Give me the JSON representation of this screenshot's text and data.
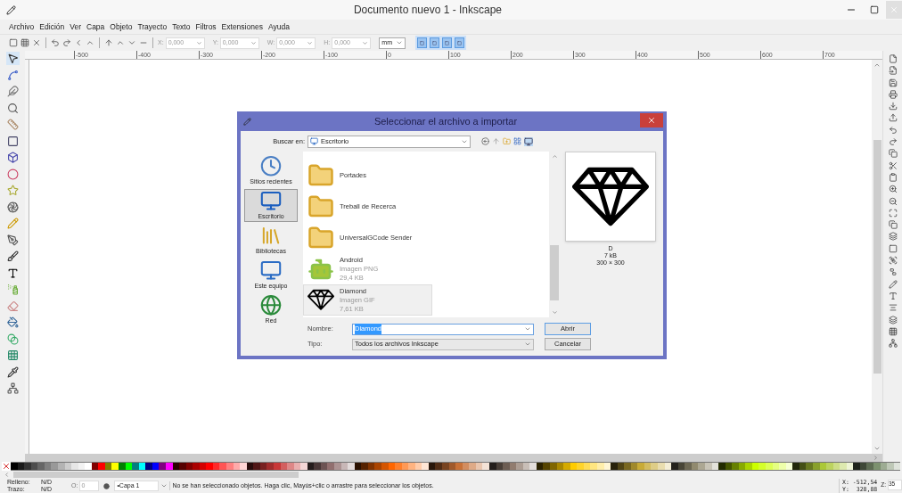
{
  "window": {
    "title": "Documento nuevo 1 - Inkscape"
  },
  "menu": [
    "Archivo",
    "Edición",
    "Ver",
    "Capa",
    "Objeto",
    "Trayecto",
    "Texto",
    "Filtros",
    "Extensiones",
    "Ayuda"
  ],
  "toolbar": {
    "fields": [
      {
        "label": "X:",
        "value": "0,000"
      },
      {
        "label": "Y:",
        "value": "0,000"
      },
      {
        "label": "W:",
        "value": "0,000"
      },
      {
        "label": "H:",
        "value": "0,000"
      }
    ],
    "unit": "mm",
    "toggles": [
      {
        "on": true
      },
      {
        "on": true
      },
      {
        "on": true
      },
      {
        "on": true
      }
    ]
  },
  "ruler": [
    "-500",
    "-400",
    "-300",
    "-200",
    "-100",
    "0",
    "100",
    "200",
    "300",
    "400",
    "500",
    "600",
    "700"
  ],
  "dialog": {
    "title": "Seleccionar el archivo a importar",
    "look_in_label": "Buscar en:",
    "look_in": "Escritorio",
    "places": [
      {
        "label": "Sitios recientes",
        "selected": false
      },
      {
        "label": "Escritorio",
        "selected": true
      },
      {
        "label": "Bibliotecas",
        "selected": false
      },
      {
        "label": "Este equipo",
        "selected": false
      },
      {
        "label": "Red",
        "selected": false
      }
    ],
    "files": [
      {
        "kind": "folder",
        "name": "Portades",
        "selected": false
      },
      {
        "kind": "folder",
        "name": "Treball de Recerca",
        "selected": false
      },
      {
        "kind": "folder",
        "name": "UniversalGCode Sender",
        "selected": false
      },
      {
        "kind": "png",
        "name": "Android",
        "type": "Imagen PNG",
        "size": "29,4 KB",
        "selected": false
      },
      {
        "kind": "gif",
        "name": "Diamond",
        "type": "Imagen GIF",
        "size": "7,61 KB",
        "selected": true
      }
    ],
    "preview_info": [
      "D",
      "7 kB",
      "300 × 300"
    ],
    "name_label": "Nombre:",
    "name_value": "Diamond",
    "type_label": "Tipo:",
    "type_value": "Todos los archivos Inkscape",
    "open": "Abrir",
    "cancel": "Cancelar"
  },
  "palette": [
    {
      "color": "#000000"
    },
    {
      "color": "#1a1a1a"
    },
    {
      "color": "#333333"
    },
    {
      "color": "#4d4d4d"
    },
    {
      "color": "#666666"
    },
    {
      "color": "#808080"
    },
    {
      "color": "#999999"
    },
    {
      "color": "#b3b3b3"
    },
    {
      "color": "#cccccc"
    },
    {
      "color": "#e6e6e6"
    },
    {
      "color": "#f2f2f2"
    },
    {
      "color": "#ffffff"
    },
    {
      "color": "#800000"
    },
    {
      "color": "#ff0000"
    },
    {
      "color": "#808000"
    },
    {
      "color": "#ffff00"
    },
    {
      "color": "#008000"
    },
    {
      "color": "#00ff00"
    },
    {
      "color": "#008080"
    },
    {
      "color": "#00ffff"
    },
    {
      "color": "#000080"
    },
    {
      "color": "#0000ff"
    },
    {
      "color": "#800080"
    },
    {
      "color": "#ff00ff"
    },
    {
      "color": "#2b0000"
    },
    {
      "color": "#550000"
    },
    {
      "color": "#800000"
    },
    {
      "color": "#aa0000"
    },
    {
      "color": "#d40000"
    },
    {
      "color": "#ff0000"
    },
    {
      "color": "#ff2a2a"
    },
    {
      "color": "#ff5555"
    },
    {
      "color": "#ff8080"
    },
    {
      "color": "#ffaaaa"
    },
    {
      "color": "#ffd5d5"
    },
    {
      "color": "#280b0b"
    },
    {
      "color": "#501616"
    },
    {
      "color": "#782121"
    },
    {
      "color": "#a02c2c"
    },
    {
      "color": "#c83737"
    },
    {
      "color": "#d35f5f"
    },
    {
      "color": "#de8787"
    },
    {
      "color": "#e9afaf"
    },
    {
      "color": "#f4d7d7"
    },
    {
      "color": "#241c1c"
    },
    {
      "color": "#483737"
    },
    {
      "color": "#6c5353"
    },
    {
      "color": "#916f6f"
    },
    {
      "color": "#ac9393"
    },
    {
      "color": "#c8b7b7"
    },
    {
      "color": "#e3dbdb"
    },
    {
      "color": "#2b1100"
    },
    {
      "color": "#552200"
    },
    {
      "color": "#803300"
    },
    {
      "color": "#aa4400"
    },
    {
      "color": "#d45500"
    },
    {
      "color": "#ff6600"
    },
    {
      "color": "#ff7f2a"
    },
    {
      "color": "#ff9955"
    },
    {
      "color": "#ffb380"
    },
    {
      "color": "#ffccaa"
    },
    {
      "color": "#ffe6d5"
    },
    {
      "color": "#28170b"
    },
    {
      "color": "#502d16"
    },
    {
      "color": "#784421"
    },
    {
      "color": "#a05a2c"
    },
    {
      "color": "#c87137"
    },
    {
      "color": "#d38d5f"
    },
    {
      "color": "#deaa87"
    },
    {
      "color": "#e9c6af"
    },
    {
      "color": "#f4e3d7"
    },
    {
      "color": "#241f1c"
    },
    {
      "color": "#483e37"
    },
    {
      "color": "#6c5d53"
    },
    {
      "color": "#917c6f"
    },
    {
      "color": "#ac9d93"
    },
    {
      "color": "#c8beb7"
    },
    {
      "color": "#e3dedb"
    },
    {
      "color": "#2b2200"
    },
    {
      "color": "#554400"
    },
    {
      "color": "#806600"
    },
    {
      "color": "#aa8800"
    },
    {
      "color": "#d4aa00"
    },
    {
      "color": "#ffcc00"
    },
    {
      "color": "#ffd42a"
    },
    {
      "color": "#ffdd55"
    },
    {
      "color": "#ffe680"
    },
    {
      "color": "#ffeeaa"
    },
    {
      "color": "#fff6d5"
    },
    {
      "color": "#28220b"
    },
    {
      "color": "#504416"
    },
    {
      "color": "#786721"
    },
    {
      "color": "#a0892c"
    },
    {
      "color": "#c8ab37"
    },
    {
      "color": "#d3bc5f"
    },
    {
      "color": "#decd87"
    },
    {
      "color": "#e9ddaf"
    },
    {
      "color": "#f4eed7"
    },
    {
      "color": "#24221c"
    },
    {
      "color": "#484537"
    },
    {
      "color": "#6c6753"
    },
    {
      "color": "#918a6f"
    },
    {
      "color": "#aca793"
    },
    {
      "color": "#c8c4b7"
    },
    {
      "color": "#e3e2db"
    },
    {
      "color": "#222b00"
    },
    {
      "color": "#445500"
    },
    {
      "color": "#668000"
    },
    {
      "color": "#88aa00"
    },
    {
      "color": "#aad400"
    },
    {
      "color": "#ccff00"
    },
    {
      "color": "#d4ff2a"
    },
    {
      "color": "#ddff55"
    },
    {
      "color": "#e5ff80"
    },
    {
      "color": "#eeffaa"
    },
    {
      "color": "#f6ffd5"
    },
    {
      "color": "#22280b"
    },
    {
      "color": "#445016"
    },
    {
      "color": "#677821"
    },
    {
      "color": "#89a02c"
    },
    {
      "color": "#abc837"
    },
    {
      "color": "#bcd35f"
    },
    {
      "color": "#cdde87"
    },
    {
      "color": "#dde9af"
    },
    {
      "color": "#eef4d7"
    },
    {
      "color": "#1f241c"
    },
    {
      "color": "#3e4837"
    },
    {
      "color": "#5d6c53"
    },
    {
      "color": "#7c916f"
    },
    {
      "color": "#9dac93"
    },
    {
      "color": "#bec8b7"
    },
    {
      "color": "#dee3db"
    }
  ],
  "status": {
    "fill_label": "Relleno:",
    "fill_value": "N/D",
    "stroke_label": "Trazo:",
    "stroke_value": "N/D",
    "opacity_label": "O:",
    "opacity_value": "0",
    "layer": "•Capa 1",
    "message": "No se han seleccionado objetos. Haga clic, Mayús+clic o arrastre para seleccionar los objetos.",
    "x": "X: -512,54",
    "y": "Y:  328,88",
    "zoom_label": "Z:",
    "zoom_value": "35"
  }
}
